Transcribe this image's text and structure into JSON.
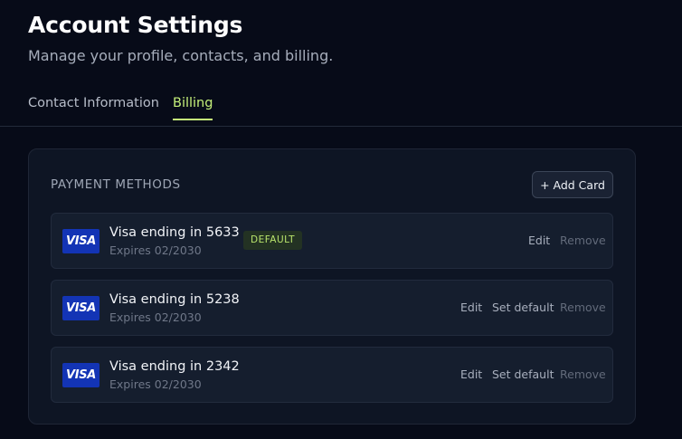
{
  "header": {
    "title": "Account Settings",
    "subtitle": "Manage your profile, contacts, and billing."
  },
  "tabs": [
    {
      "label": "Contact Information",
      "active": false
    },
    {
      "label": "Billing",
      "active": true
    }
  ],
  "billing": {
    "section_label": "PAYMENT METHODS",
    "add_card_label": "+ Add Card",
    "methods": [
      {
        "brand": "VISA",
        "name": "Visa ending in 5633",
        "expires": "Expires 02/2030",
        "badge": "DEFAULT",
        "actions": {
          "edit": "Edit",
          "remove": "Remove"
        }
      },
      {
        "brand": "VISA",
        "name": "Visa ending in 5238",
        "expires": "Expires 02/2030",
        "actions": {
          "edit": "Edit",
          "set_default": "Set default",
          "remove": "Remove"
        }
      },
      {
        "brand": "VISA",
        "name": "Visa ending in 2342",
        "expires": "Expires 02/2030",
        "actions": {
          "edit": "Edit",
          "set_default": "Set default",
          "remove": "Remove"
        }
      }
    ]
  },
  "colors": {
    "background": "#070b18",
    "accent": "#c5f07a",
    "card": "#0e1524",
    "visa_blue": "#1334b5"
  }
}
